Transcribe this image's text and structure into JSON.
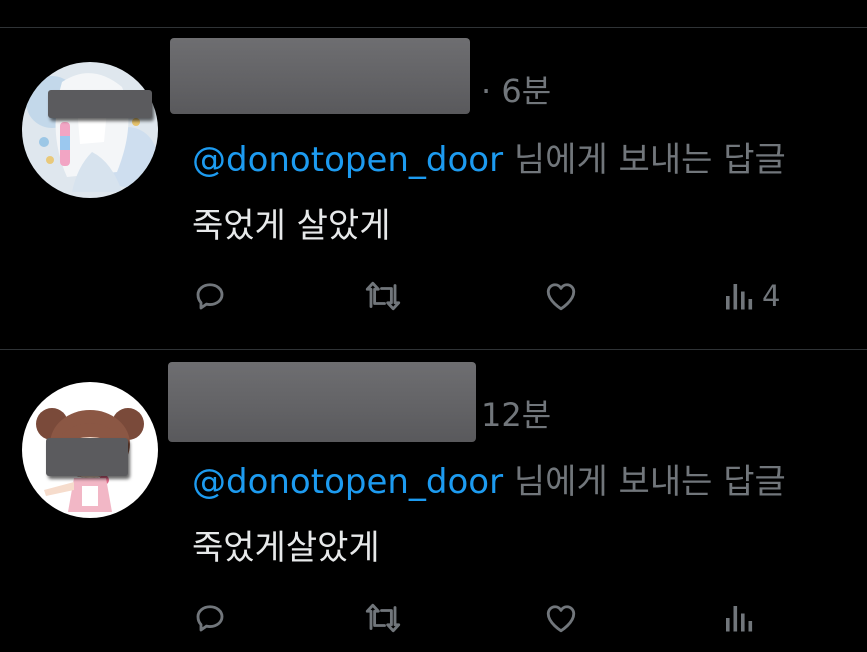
{
  "tweets": [
    {
      "time": "· 6분",
      "mention": "@donotopen_door",
      "reply_suffix": " 님에게 보내는 답글",
      "text": "죽었게 살았게",
      "views": "4",
      "avatar_theme": "white-haired anime illustration, pastel"
    },
    {
      "time": "12분",
      "mention": "@donotopen_door",
      "reply_suffix": " 님에게 보내는 답글",
      "text": "죽었게살았게",
      "views": "",
      "avatar_theme": "chibi girl with brown pigtails, pink outfit"
    }
  ],
  "icons": {
    "reply": "reply-icon",
    "retweet": "retweet-icon",
    "like": "heart-icon",
    "views": "views-icon"
  },
  "colors": {
    "background": "#000000",
    "text": "#e7e9ea",
    "muted": "#71767b",
    "mention": "#1d9bf0",
    "divider": "#2f3336",
    "redaction": "#5b5b5e"
  }
}
